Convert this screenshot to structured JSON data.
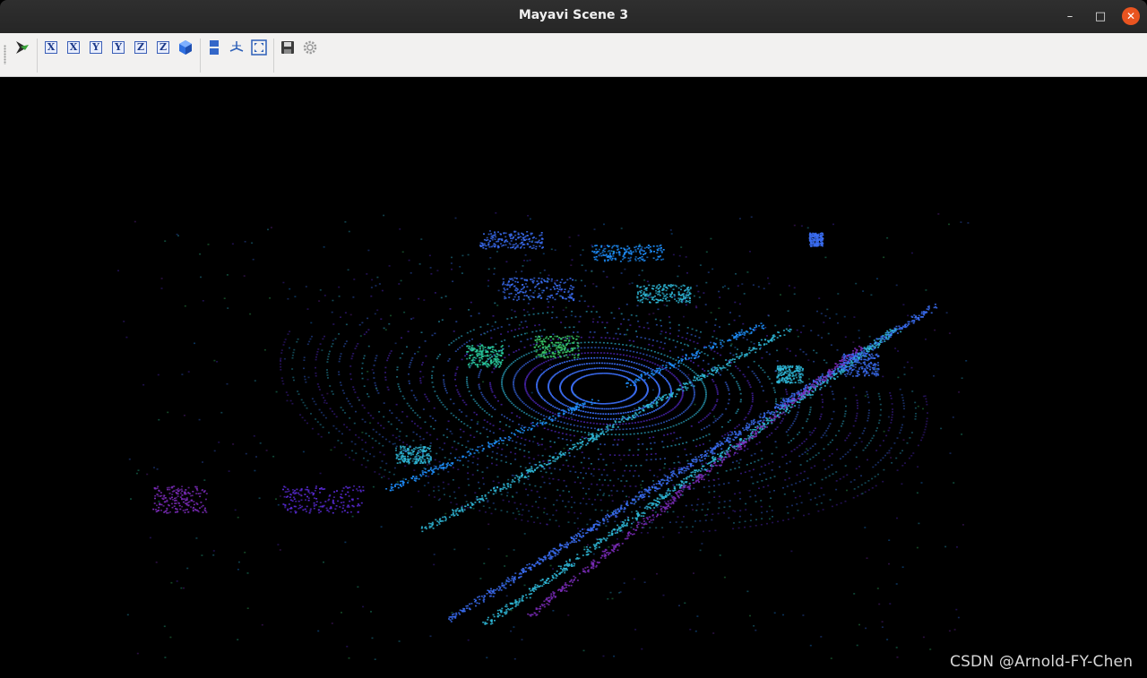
{
  "window": {
    "title": "Mayavi Scene 3",
    "controls": {
      "minimize": "–",
      "maximize": "□",
      "close": "✕"
    }
  },
  "toolbar": {
    "buttons": [
      {
        "name": "mayavi-pipeline-icon"
      },
      {
        "name": "view-x-positive-icon",
        "glyph": "X"
      },
      {
        "name": "view-x-negative-icon",
        "glyph": "X"
      },
      {
        "name": "view-y-positive-icon",
        "glyph": "Y"
      },
      {
        "name": "view-y-negative-icon",
        "glyph": "Y"
      },
      {
        "name": "view-z-positive-icon",
        "glyph": "Z"
      },
      {
        "name": "view-z-negative-icon",
        "glyph": "Z"
      },
      {
        "name": "isometric-view-icon"
      },
      {
        "name": "parallel-projection-icon"
      },
      {
        "name": "toggle-axes-icon"
      },
      {
        "name": "full-screen-icon"
      },
      {
        "name": "save-icon"
      },
      {
        "name": "settings-gear-icon"
      }
    ]
  },
  "scene": {
    "background": "#000000",
    "colors": [
      "#3a6cf0",
      "#2fb8d8",
      "#2ad0a0",
      "#5a2bd8",
      "#7a2bb8",
      "#1e90ff",
      "#39c96a"
    ]
  },
  "watermark": "CSDN @Arnold-FY-Chen"
}
